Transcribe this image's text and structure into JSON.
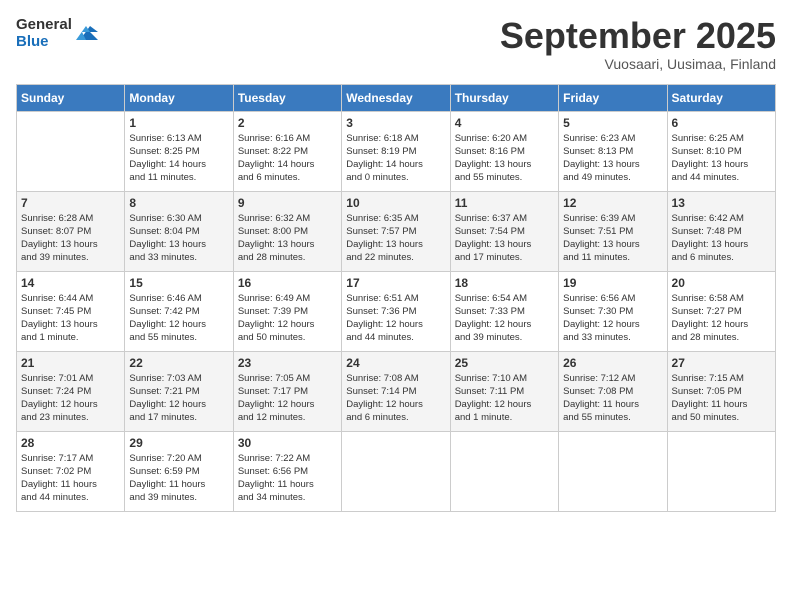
{
  "header": {
    "logo_general": "General",
    "logo_blue": "Blue",
    "month_title": "September 2025",
    "location": "Vuosaari, Uusimaa, Finland"
  },
  "days_of_week": [
    "Sunday",
    "Monday",
    "Tuesday",
    "Wednesday",
    "Thursday",
    "Friday",
    "Saturday"
  ],
  "weeks": [
    [
      {
        "day": "",
        "info": ""
      },
      {
        "day": "1",
        "info": "Sunrise: 6:13 AM\nSunset: 8:25 PM\nDaylight: 14 hours\nand 11 minutes."
      },
      {
        "day": "2",
        "info": "Sunrise: 6:16 AM\nSunset: 8:22 PM\nDaylight: 14 hours\nand 6 minutes."
      },
      {
        "day": "3",
        "info": "Sunrise: 6:18 AM\nSunset: 8:19 PM\nDaylight: 14 hours\nand 0 minutes."
      },
      {
        "day": "4",
        "info": "Sunrise: 6:20 AM\nSunset: 8:16 PM\nDaylight: 13 hours\nand 55 minutes."
      },
      {
        "day": "5",
        "info": "Sunrise: 6:23 AM\nSunset: 8:13 PM\nDaylight: 13 hours\nand 49 minutes."
      },
      {
        "day": "6",
        "info": "Sunrise: 6:25 AM\nSunset: 8:10 PM\nDaylight: 13 hours\nand 44 minutes."
      }
    ],
    [
      {
        "day": "7",
        "info": "Sunrise: 6:28 AM\nSunset: 8:07 PM\nDaylight: 13 hours\nand 39 minutes."
      },
      {
        "day": "8",
        "info": "Sunrise: 6:30 AM\nSunset: 8:04 PM\nDaylight: 13 hours\nand 33 minutes."
      },
      {
        "day": "9",
        "info": "Sunrise: 6:32 AM\nSunset: 8:00 PM\nDaylight: 13 hours\nand 28 minutes."
      },
      {
        "day": "10",
        "info": "Sunrise: 6:35 AM\nSunset: 7:57 PM\nDaylight: 13 hours\nand 22 minutes."
      },
      {
        "day": "11",
        "info": "Sunrise: 6:37 AM\nSunset: 7:54 PM\nDaylight: 13 hours\nand 17 minutes."
      },
      {
        "day": "12",
        "info": "Sunrise: 6:39 AM\nSunset: 7:51 PM\nDaylight: 13 hours\nand 11 minutes."
      },
      {
        "day": "13",
        "info": "Sunrise: 6:42 AM\nSunset: 7:48 PM\nDaylight: 13 hours\nand 6 minutes."
      }
    ],
    [
      {
        "day": "14",
        "info": "Sunrise: 6:44 AM\nSunset: 7:45 PM\nDaylight: 13 hours\nand 1 minute."
      },
      {
        "day": "15",
        "info": "Sunrise: 6:46 AM\nSunset: 7:42 PM\nDaylight: 12 hours\nand 55 minutes."
      },
      {
        "day": "16",
        "info": "Sunrise: 6:49 AM\nSunset: 7:39 PM\nDaylight: 12 hours\nand 50 minutes."
      },
      {
        "day": "17",
        "info": "Sunrise: 6:51 AM\nSunset: 7:36 PM\nDaylight: 12 hours\nand 44 minutes."
      },
      {
        "day": "18",
        "info": "Sunrise: 6:54 AM\nSunset: 7:33 PM\nDaylight: 12 hours\nand 39 minutes."
      },
      {
        "day": "19",
        "info": "Sunrise: 6:56 AM\nSunset: 7:30 PM\nDaylight: 12 hours\nand 33 minutes."
      },
      {
        "day": "20",
        "info": "Sunrise: 6:58 AM\nSunset: 7:27 PM\nDaylight: 12 hours\nand 28 minutes."
      }
    ],
    [
      {
        "day": "21",
        "info": "Sunrise: 7:01 AM\nSunset: 7:24 PM\nDaylight: 12 hours\nand 23 minutes."
      },
      {
        "day": "22",
        "info": "Sunrise: 7:03 AM\nSunset: 7:21 PM\nDaylight: 12 hours\nand 17 minutes."
      },
      {
        "day": "23",
        "info": "Sunrise: 7:05 AM\nSunset: 7:17 PM\nDaylight: 12 hours\nand 12 minutes."
      },
      {
        "day": "24",
        "info": "Sunrise: 7:08 AM\nSunset: 7:14 PM\nDaylight: 12 hours\nand 6 minutes."
      },
      {
        "day": "25",
        "info": "Sunrise: 7:10 AM\nSunset: 7:11 PM\nDaylight: 12 hours\nand 1 minute."
      },
      {
        "day": "26",
        "info": "Sunrise: 7:12 AM\nSunset: 7:08 PM\nDaylight: 11 hours\nand 55 minutes."
      },
      {
        "day": "27",
        "info": "Sunrise: 7:15 AM\nSunset: 7:05 PM\nDaylight: 11 hours\nand 50 minutes."
      }
    ],
    [
      {
        "day": "28",
        "info": "Sunrise: 7:17 AM\nSunset: 7:02 PM\nDaylight: 11 hours\nand 44 minutes."
      },
      {
        "day": "29",
        "info": "Sunrise: 7:20 AM\nSunset: 6:59 PM\nDaylight: 11 hours\nand 39 minutes."
      },
      {
        "day": "30",
        "info": "Sunrise: 7:22 AM\nSunset: 6:56 PM\nDaylight: 11 hours\nand 34 minutes."
      },
      {
        "day": "",
        "info": ""
      },
      {
        "day": "",
        "info": ""
      },
      {
        "day": "",
        "info": ""
      },
      {
        "day": "",
        "info": ""
      }
    ]
  ]
}
